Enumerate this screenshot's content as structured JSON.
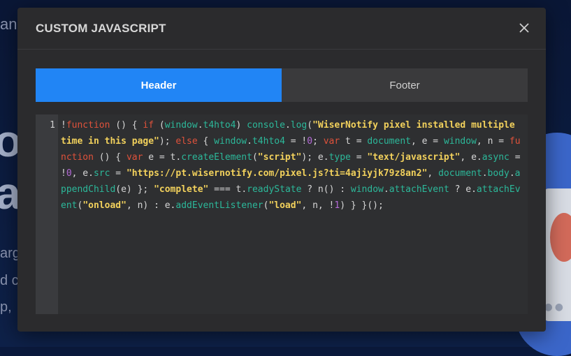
{
  "background": {
    "fragments": [
      "an",
      "o",
      "a",
      "arg",
      "d c",
      "p,"
    ]
  },
  "modal": {
    "title": "CUSTOM JAVASCRIPT",
    "close_icon": "close-icon",
    "tabs": [
      {
        "label": "Header",
        "active": true
      },
      {
        "label": "Footer",
        "active": false
      }
    ],
    "editor": {
      "line_number": "1",
      "code": "!function () { if (window.t4hto4) console.log(\"WiserNotify pixel installed multiple time in this page\"); else { window.t4hto4 = !0; var t = document, e = window, n = function () { var e = t.createElement(\"script\"); e.type = \"text/javascript\", e.async = !0, e.src = \"https://pt.wisernotify.com/pixel.js?ti=4ajiyjk79z8an2\", document.body.appendChild(e) }; \"complete\" === t.readyState ? n() : window.attachEvent ? e.attachEvent(\"onload\", n) : e.addEventListener(\"load\", n, !1) } }();"
    }
  },
  "colors": {
    "accent": "#2185f5",
    "keyword": "#e0523b",
    "string": "#f2d15c",
    "property": "#2cb89a",
    "number": "#b56ad8"
  }
}
